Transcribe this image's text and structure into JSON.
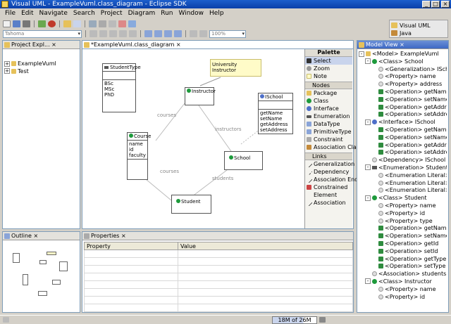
{
  "window": {
    "title": "Visual UML - ExampleVuml.class_diagram - Eclipse SDK"
  },
  "menu": [
    "File",
    "Edit",
    "Navigate",
    "Search",
    "Project",
    "Diagram",
    "Run",
    "Window",
    "Help"
  ],
  "toolbar": {
    "font_combo": "Tahoma",
    "zoom_combo": "100%"
  },
  "perspective": {
    "current": "Visual UML",
    "other": "Java"
  },
  "project_explorer": {
    "tab": "Project Expl...",
    "items": [
      "ExampleVuml",
      "Test"
    ]
  },
  "editor": {
    "tab": "*ExampleVuml.class_diagram"
  },
  "diagram": {
    "note": "University Instructor",
    "student_type": {
      "name": "StudentType",
      "literals": "BSc\nMSc\nPhD"
    },
    "instructor": {
      "name": "Instructor"
    },
    "ischool": {
      "name": "ISchool",
      "ops": "getName\nsetName\ngetAddress\nsetAddress"
    },
    "course": {
      "name": "Course",
      "attrs": "name\nid\nfaculty"
    },
    "school": {
      "name": "School"
    },
    "student": {
      "name": "Student"
    },
    "assoc_labels": {
      "courses_top": "courses",
      "instructors": "instructors",
      "courses_bottom": "courses",
      "students": "students"
    }
  },
  "palette": {
    "title": "Palette",
    "tools": [
      "Select",
      "Zoom",
      "Note"
    ],
    "nodes_drawer": "Nodes",
    "nodes": [
      "Package",
      "Class",
      "Interface",
      "Enumeration",
      "DataType",
      "PrimitiveType",
      "Constraint",
      "Association Class"
    ],
    "links_drawer": "Links",
    "links": [
      "Generalization",
      "Dependency",
      "Association End",
      "Constrained",
      "Element",
      "Association"
    ]
  },
  "model_view": {
    "tab": "Model View",
    "rows": [
      {
        "d": 0,
        "i": "fold",
        "t": "<Model> ExampleVuml",
        "e": "-"
      },
      {
        "d": 1,
        "i": "cls",
        "t": "<Class> School",
        "e": "-"
      },
      {
        "d": 2,
        "i": "prop",
        "t": "<Generalization> ISchool"
      },
      {
        "d": 2,
        "i": "prop",
        "t": "<Property> name"
      },
      {
        "d": 2,
        "i": "prop",
        "t": "<Property> address"
      },
      {
        "d": 2,
        "i": "op",
        "t": "<Operation> getName"
      },
      {
        "d": 2,
        "i": "op",
        "t": "<Operation> setName"
      },
      {
        "d": 2,
        "i": "op",
        "t": "<Operation> getAddress"
      },
      {
        "d": 2,
        "i": "op",
        "t": "<Operation> setAddress"
      },
      {
        "d": 1,
        "i": "intf",
        "t": "<Interface> ISchool",
        "e": "-"
      },
      {
        "d": 2,
        "i": "op",
        "t": "<Operation> getName"
      },
      {
        "d": 2,
        "i": "op",
        "t": "<Operation> setName"
      },
      {
        "d": 2,
        "i": "op",
        "t": "<Operation> getAddress"
      },
      {
        "d": 2,
        "i": "op",
        "t": "<Operation> setAddress"
      },
      {
        "d": 1,
        "i": "prop",
        "t": "<Dependency> ISchool"
      },
      {
        "d": 1,
        "i": "en",
        "t": "<Enumeration> StudentType",
        "e": "-"
      },
      {
        "d": 2,
        "i": "prop",
        "t": "<Enumeration Literal> BSc"
      },
      {
        "d": 2,
        "i": "prop",
        "t": "<Enumeration Literal> MSc"
      },
      {
        "d": 2,
        "i": "prop",
        "t": "<Enumeration Literal> PhD"
      },
      {
        "d": 1,
        "i": "cls",
        "t": "<Class> Student",
        "e": "-"
      },
      {
        "d": 2,
        "i": "prop",
        "t": "<Property> name"
      },
      {
        "d": 2,
        "i": "prop",
        "t": "<Property> id"
      },
      {
        "d": 2,
        "i": "prop",
        "t": "<Property> type"
      },
      {
        "d": 2,
        "i": "op",
        "t": "<Operation> getName"
      },
      {
        "d": 2,
        "i": "op",
        "t": "<Operation> setName"
      },
      {
        "d": 2,
        "i": "op",
        "t": "<Operation> getId"
      },
      {
        "d": 2,
        "i": "op",
        "t": "<Operation> setId"
      },
      {
        "d": 2,
        "i": "op",
        "t": "<Operation> getType"
      },
      {
        "d": 2,
        "i": "op",
        "t": "<Operation> setType"
      },
      {
        "d": 1,
        "i": "prop",
        "t": "<Association> students"
      },
      {
        "d": 1,
        "i": "cls",
        "t": "<Class> Instructor",
        "e": "-"
      },
      {
        "d": 2,
        "i": "prop",
        "t": "<Property> name"
      },
      {
        "d": 2,
        "i": "prop",
        "t": "<Property> id"
      }
    ]
  },
  "outline": {
    "tab": "Outline"
  },
  "properties": {
    "tab": "Properties",
    "col_property": "Property",
    "col_value": "Value"
  },
  "status": {
    "heap": "18M of 26M"
  }
}
